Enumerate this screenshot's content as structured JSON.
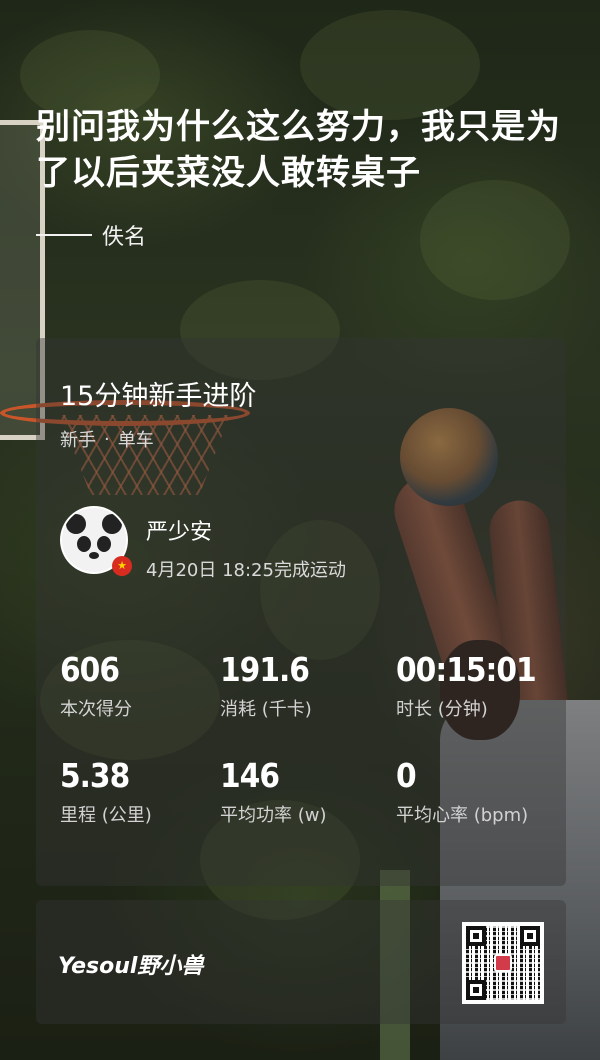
{
  "quote": {
    "text": "别问我为什么这么努力，我只是为了以后夹菜没人敢转桌子",
    "author": "佚名"
  },
  "workout": {
    "title": "15分钟新手进阶",
    "level": "新手",
    "separator": "·",
    "equipment": "单车"
  },
  "user": {
    "name": "严少安",
    "completed": "4月20日 18:25完成运动",
    "avatar_icon": "panda-avatar-icon",
    "badge_icon": "china-flag-icon"
  },
  "stats": [
    {
      "value": "606",
      "label": "本次得分"
    },
    {
      "value": "191.6",
      "label": "消耗 (千卡)"
    },
    {
      "value": "00:15:01",
      "label": "时长 (分钟)"
    },
    {
      "value": "5.38",
      "label": "里程 (公里)"
    },
    {
      "value": "146",
      "label": "平均功率 (w)"
    },
    {
      "value": "0",
      "label": "平均心率 (bpm)"
    }
  ],
  "footer": {
    "brand": "Yesoul野小兽",
    "qr_icon": "qr-code-icon"
  },
  "colors": {
    "card_background": "#343434",
    "text_primary": "#ffffff",
    "text_secondary": "#d9d9d9"
  }
}
